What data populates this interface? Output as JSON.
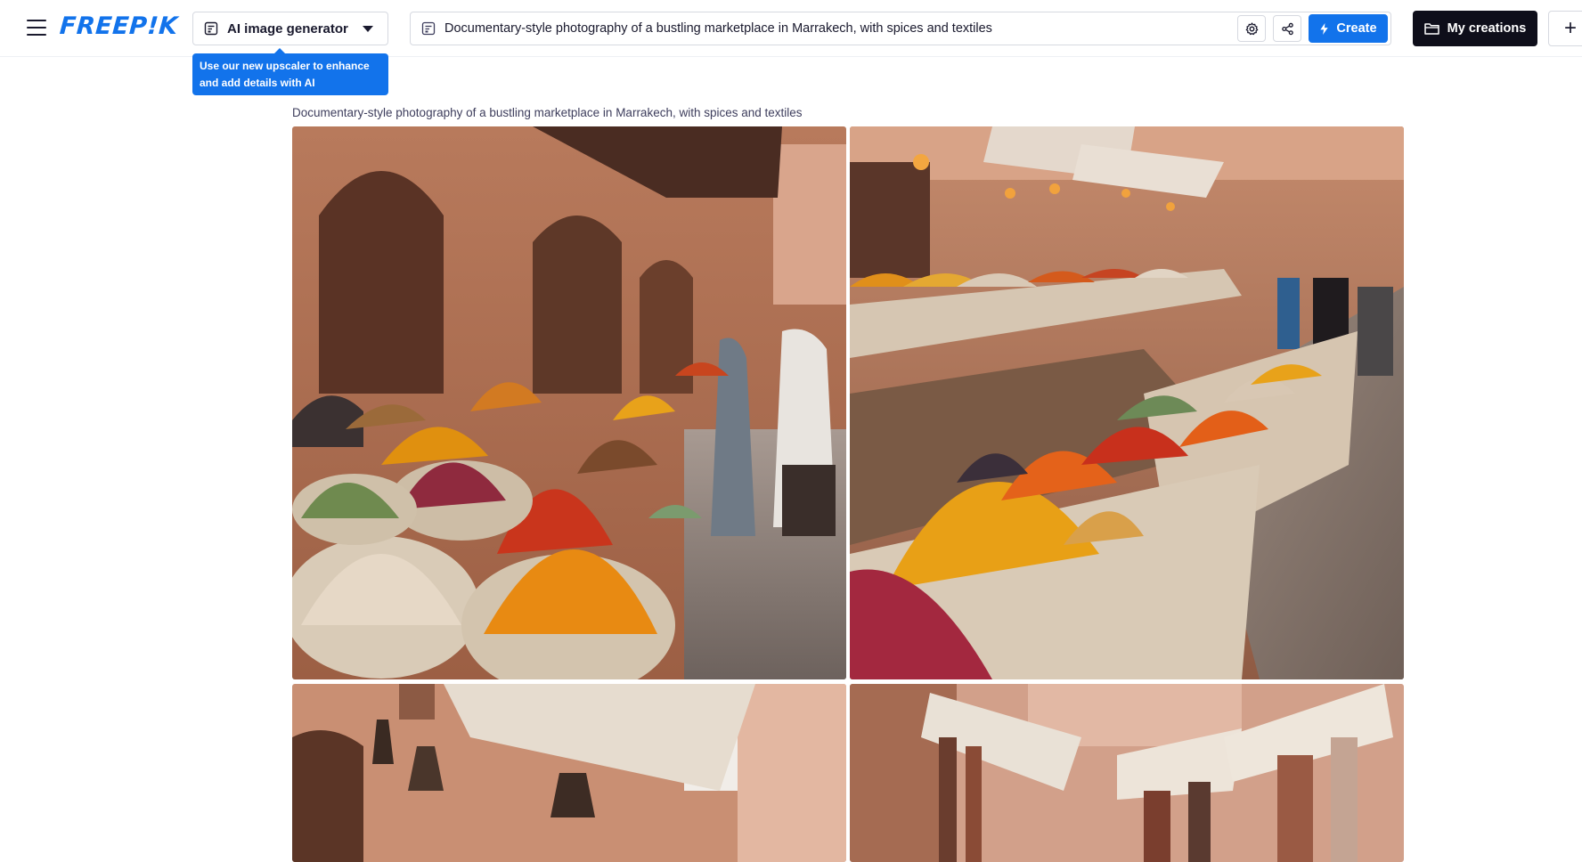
{
  "header": {
    "logo_text": "FREEP!K",
    "tool_selector": {
      "label": "AI image generator"
    },
    "tooltip": "Use our new upscaler to enhance and add details with AI",
    "prompt": {
      "value": "Documentary-style photography of a bustling marketplace in Marrakech, with spices and textiles"
    },
    "create_label": "Create",
    "my_creations_label": "My creations",
    "new_label": "+"
  },
  "main": {
    "result_caption": "Documentary-style photography of a bustling marketplace in Marrakech, with spices and textiles",
    "images": [
      {
        "name": "generated-image-1"
      },
      {
        "name": "generated-image-2"
      },
      {
        "name": "generated-image-3"
      },
      {
        "name": "generated-image-4"
      }
    ]
  },
  "colors": {
    "accent": "#1273eb",
    "dark_button": "#0e0e1a",
    "border": "#d6d9e0"
  },
  "icons": [
    "menu-icon",
    "image-generator-icon",
    "chevron-down-icon",
    "document-icon",
    "settings-icon",
    "share-icon",
    "bolt-icon",
    "folder-icon",
    "plus-icon"
  ]
}
